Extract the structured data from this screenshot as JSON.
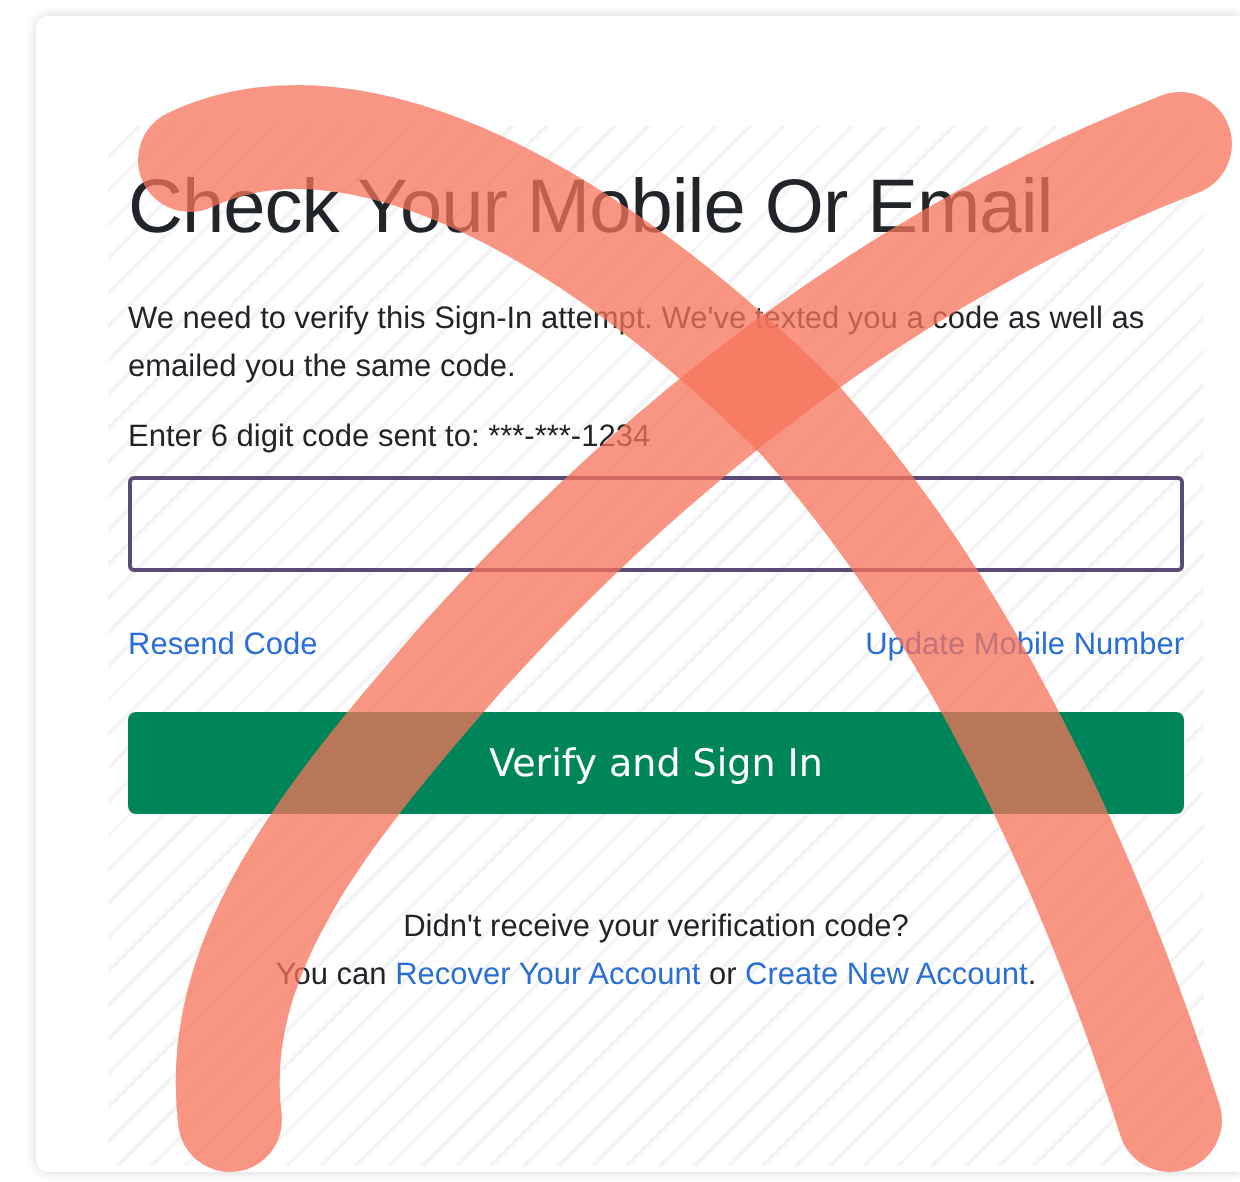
{
  "title": "Check Your Mobile Or Email",
  "message": "We need to verify this Sign-In attempt. We've texted you a code as well as emailed you the same code.",
  "code_label": "Enter 6 digit code sent to: ***-***-1234",
  "links": [
    {
      "text": "Resend Code"
    },
    {
      "text": "Update Mobile Number"
    }
  ],
  "submit_button": "Verify and Sign In",
  "footer": {
    "prompt": "Didn't receive your verification code?",
    "parts": [
      {
        "kind": "text",
        "text": "You can "
      },
      {
        "kind": "link",
        "text": "Recover Your Account"
      },
      {
        "kind": "text",
        "text": " or "
      },
      {
        "kind": "link",
        "text": "Create New Account"
      },
      {
        "kind": "text",
        "text": "."
      }
    ]
  }
}
